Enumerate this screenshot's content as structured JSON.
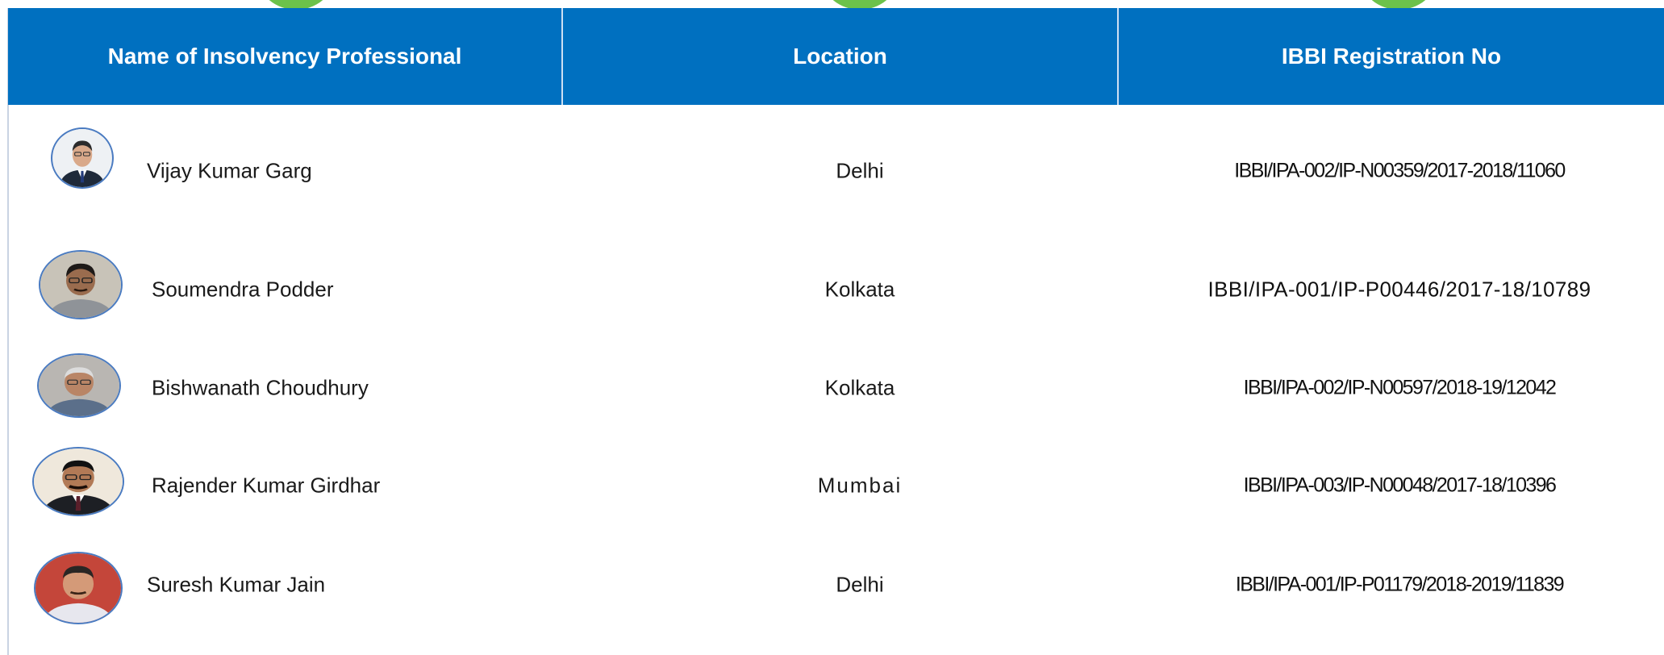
{
  "table": {
    "headers": {
      "name": "Name of Insolvency Professional",
      "location": "Location",
      "registration": "IBBI Registration No"
    },
    "rows": [
      {
        "name": "Vijay Kumar Garg",
        "location": "Delhi",
        "registration": "IBBI/IPA-002/IP-N00359/2017-2018/11060"
      },
      {
        "name": "Soumendra Podder",
        "location": "Kolkata",
        "registration": "IBBI/IPA-001/IP-P00446/2017-18/10789"
      },
      {
        "name": "Bishwanath Choudhury",
        "location": "Kolkata",
        "registration": "IBBI/IPA-002/IP-N00597/2018-19/12042"
      },
      {
        "name": "Rajender Kumar Girdhar",
        "location": "Mumbai",
        "registration": "IBBI/IPA-003/IP-N00048/2017-18/10396"
      },
      {
        "name": "Suresh Kumar Jain",
        "location": "Delhi",
        "registration": "IBBI/IPA-001/IP-P01179/2018-2019/11839"
      }
    ]
  },
  "colors": {
    "header_bg": "#0070c0",
    "header_text": "#ffffff",
    "accent_green": "#6cc24a",
    "avatar_border": "#4a7bc1"
  }
}
